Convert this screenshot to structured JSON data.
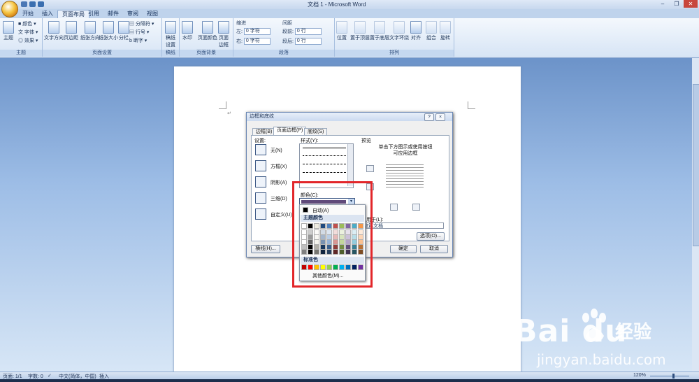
{
  "window": {
    "title": "文档 1 - Microsoft Word"
  },
  "tabs": [
    "开始",
    "插入",
    "页面布局",
    "引用",
    "邮件",
    "审阅",
    "视图"
  ],
  "active_tab": "页面布局",
  "ribbon": {
    "theme": {
      "btn": "主题",
      "colors": "颜色",
      "fonts": "字体",
      "effects": "效果",
      "label": "主题"
    },
    "page_setup": {
      "buttons": [
        "文字方向",
        "页边距",
        "纸张方向",
        "纸张大小",
        "分栏"
      ],
      "breaks": "分隔符",
      "line_numbers": "行号",
      "hyphenation": "断字",
      "label": "页面设置"
    },
    "draft": {
      "btn": "稿纸设置",
      "label": "稿纸"
    },
    "page_bg": {
      "buttons": [
        "水印",
        "页面颜色",
        "页面边框"
      ],
      "label": "页面背景"
    },
    "paragraph": {
      "indent": "缩进",
      "left": "左:",
      "left_val": "0 字符",
      "right": "右:",
      "right_val": "0 字符",
      "spacing": "间距",
      "before": "段前:",
      "before_val": "0 行",
      "after": "段后:",
      "after_val": "0 行",
      "label": "段落"
    },
    "arrange": {
      "buttons": [
        "位置",
        "置于顶层",
        "置于底层",
        "文字环绕",
        "对齐",
        "组合",
        "旋转"
      ],
      "label": "排列"
    }
  },
  "dialog": {
    "title": "边框和底纹",
    "help": "?",
    "close": "×",
    "tabs": [
      "边框(B)",
      "页面边框(P)",
      "底纹(S)"
    ],
    "active_tab": "页面边框(P)",
    "settings_label": "设置:",
    "settings": [
      "无(N)",
      "方框(X)",
      "阴影(A)",
      "三维(D)",
      "自定义(U)"
    ],
    "style_label": "样式(Y):",
    "color_label": "颜色(C):",
    "preview_label": "预览",
    "preview_hint": "单击下方图示或使用按钮可应用边框",
    "apply_label": "应用于(L):",
    "apply_value": "整篇文档",
    "options": "选项(O)...",
    "hline": "横线(H)...",
    "ok": "确定",
    "cancel": "取消"
  },
  "color_picker": {
    "auto": "自动(A)",
    "theme_colors": "主题颜色",
    "standard_colors": "标准色",
    "more_colors": "其他颜色(M)...",
    "theme_top": [
      "#ffffff",
      "#000000",
      "#eeece1",
      "#1f497d",
      "#4f81bd",
      "#c0504d",
      "#9bbb59",
      "#8064a2",
      "#4bacc6",
      "#f79646"
    ],
    "standard": [
      "#c00000",
      "#ff0000",
      "#ffc000",
      "#ffff00",
      "#92d050",
      "#00b050",
      "#00b0f0",
      "#0070c0",
      "#002060",
      "#7030a0"
    ],
    "selected_color": "#604a7b"
  },
  "status": {
    "page": "页面: 1/1",
    "words": "字数: 0",
    "lang": "中文(简体，中国)",
    "mode": "插入",
    "zoom": "120%"
  },
  "watermark": {
    "logo": "Bai du",
    "jingyan": "经验",
    "url": "jingyan.baidu.com"
  }
}
